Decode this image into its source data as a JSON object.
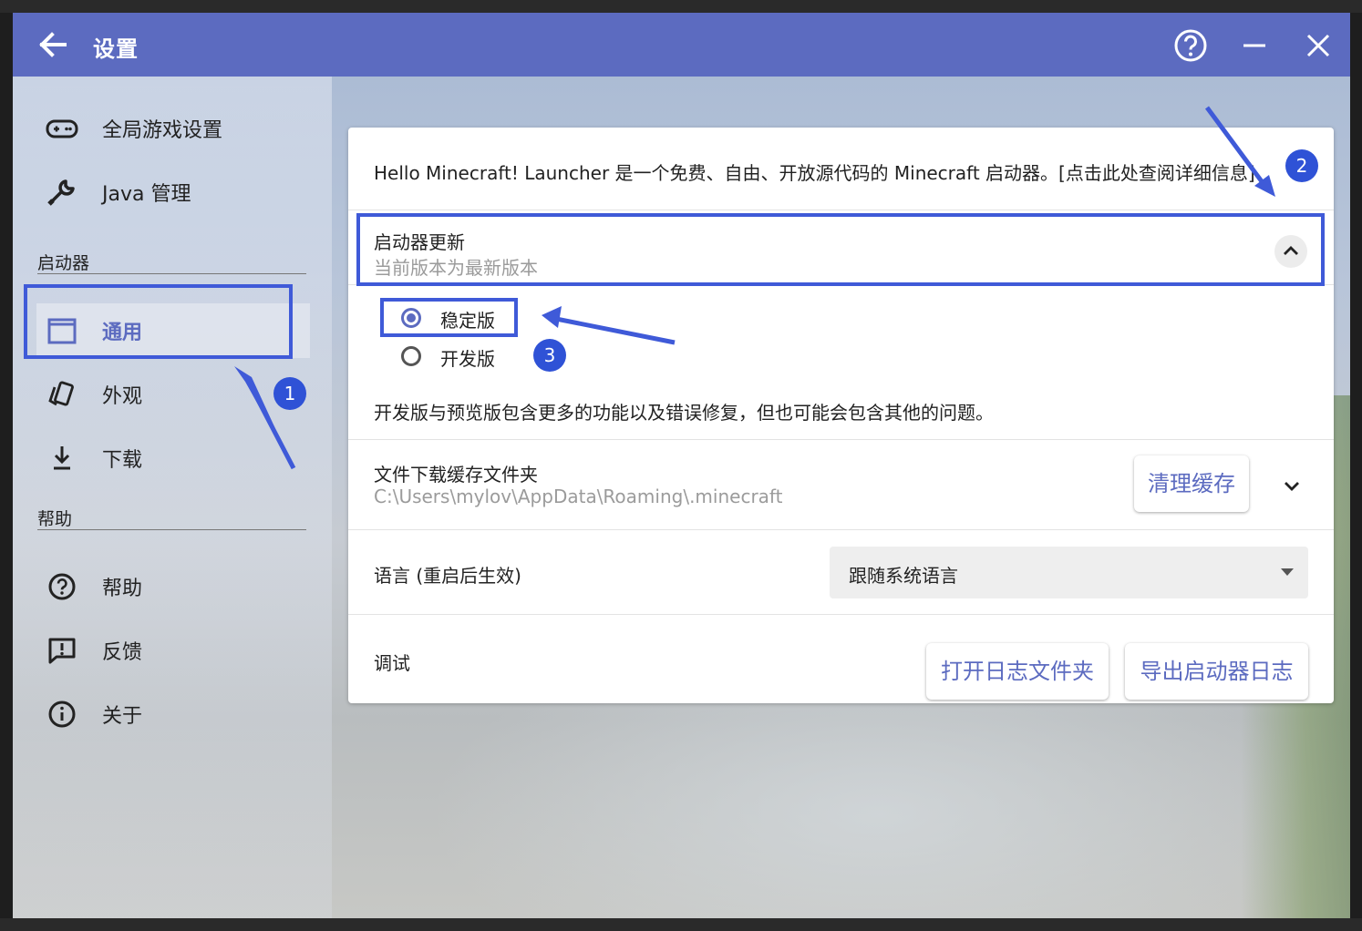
{
  "window": {
    "title": "设置",
    "back_icon": "arrow-left-icon",
    "help_icon": "help-circle-icon",
    "minimize_icon": "minimize-icon",
    "close_icon": "close-icon",
    "accent_color": "#5c6bc0"
  },
  "sidebar": {
    "items_top": [
      {
        "label": "全局游戏设置",
        "icon": "gamepad-icon"
      },
      {
        "label": "Java 管理",
        "icon": "wrench-icon"
      }
    ],
    "section_launcher": "启动器",
    "items_launcher": [
      {
        "label": "通用",
        "icon": "window-icon",
        "active": true
      },
      {
        "label": "外观",
        "icon": "cards-icon"
      },
      {
        "label": "下载",
        "icon": "download-icon"
      }
    ],
    "section_help": "帮助",
    "items_help": [
      {
        "label": "帮助",
        "icon": "help-circle-icon"
      },
      {
        "label": "反馈",
        "icon": "feedback-icon"
      },
      {
        "label": "关于",
        "icon": "info-icon"
      }
    ]
  },
  "main": {
    "about_text": "Hello Minecraft! Launcher 是一个免费、自由、开放源代码的 Minecraft 启动器。[点击此处查阅详细信息]",
    "update": {
      "title": "启动器更新",
      "subtitle": "当前版本为最新版本",
      "option_stable": "稳定版",
      "option_dev": "开发版",
      "selected": "稳定版",
      "note": "开发版与预览版包含更多的功能以及错误修复，但也可能会包含其他的问题。"
    },
    "cache": {
      "title": "文件下载缓存文件夹",
      "path": "C:\\Users\\mylov\\AppData\\Roaming\\.minecraft",
      "clear_button": "清理缓存"
    },
    "language": {
      "label": "语言 (重启后生效)",
      "value": "跟随系统语言"
    },
    "debug": {
      "label": "调试",
      "open_log_button": "打开日志文件夹",
      "export_log_button": "导出启动器日志"
    }
  },
  "annotations": {
    "badge_1": "1",
    "badge_2": "2",
    "badge_3": "3",
    "color": "#2f52d6"
  }
}
